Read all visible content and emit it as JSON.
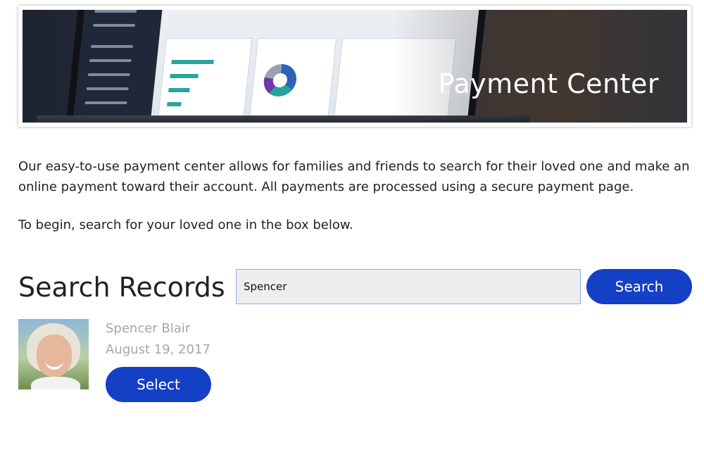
{
  "banner": {
    "title": "Payment Center"
  },
  "intro": {
    "paragraph": "Our easy-to-use payment center allows for families and friends to search for their loved one and make an online payment toward their account. All payments are processed using a secure payment page.",
    "instruction": "To begin, search for your loved one in the box below."
  },
  "search": {
    "heading": "Search Records",
    "input_value": "Spencer",
    "button_label": "Search"
  },
  "results": [
    {
      "name": "Spencer Blair",
      "date": "August 19, 2017",
      "select_label": "Select"
    }
  ],
  "colors": {
    "primary_button": "#1440c6",
    "muted_text": "#a6a6a6",
    "input_border": "#8fb2e6"
  }
}
